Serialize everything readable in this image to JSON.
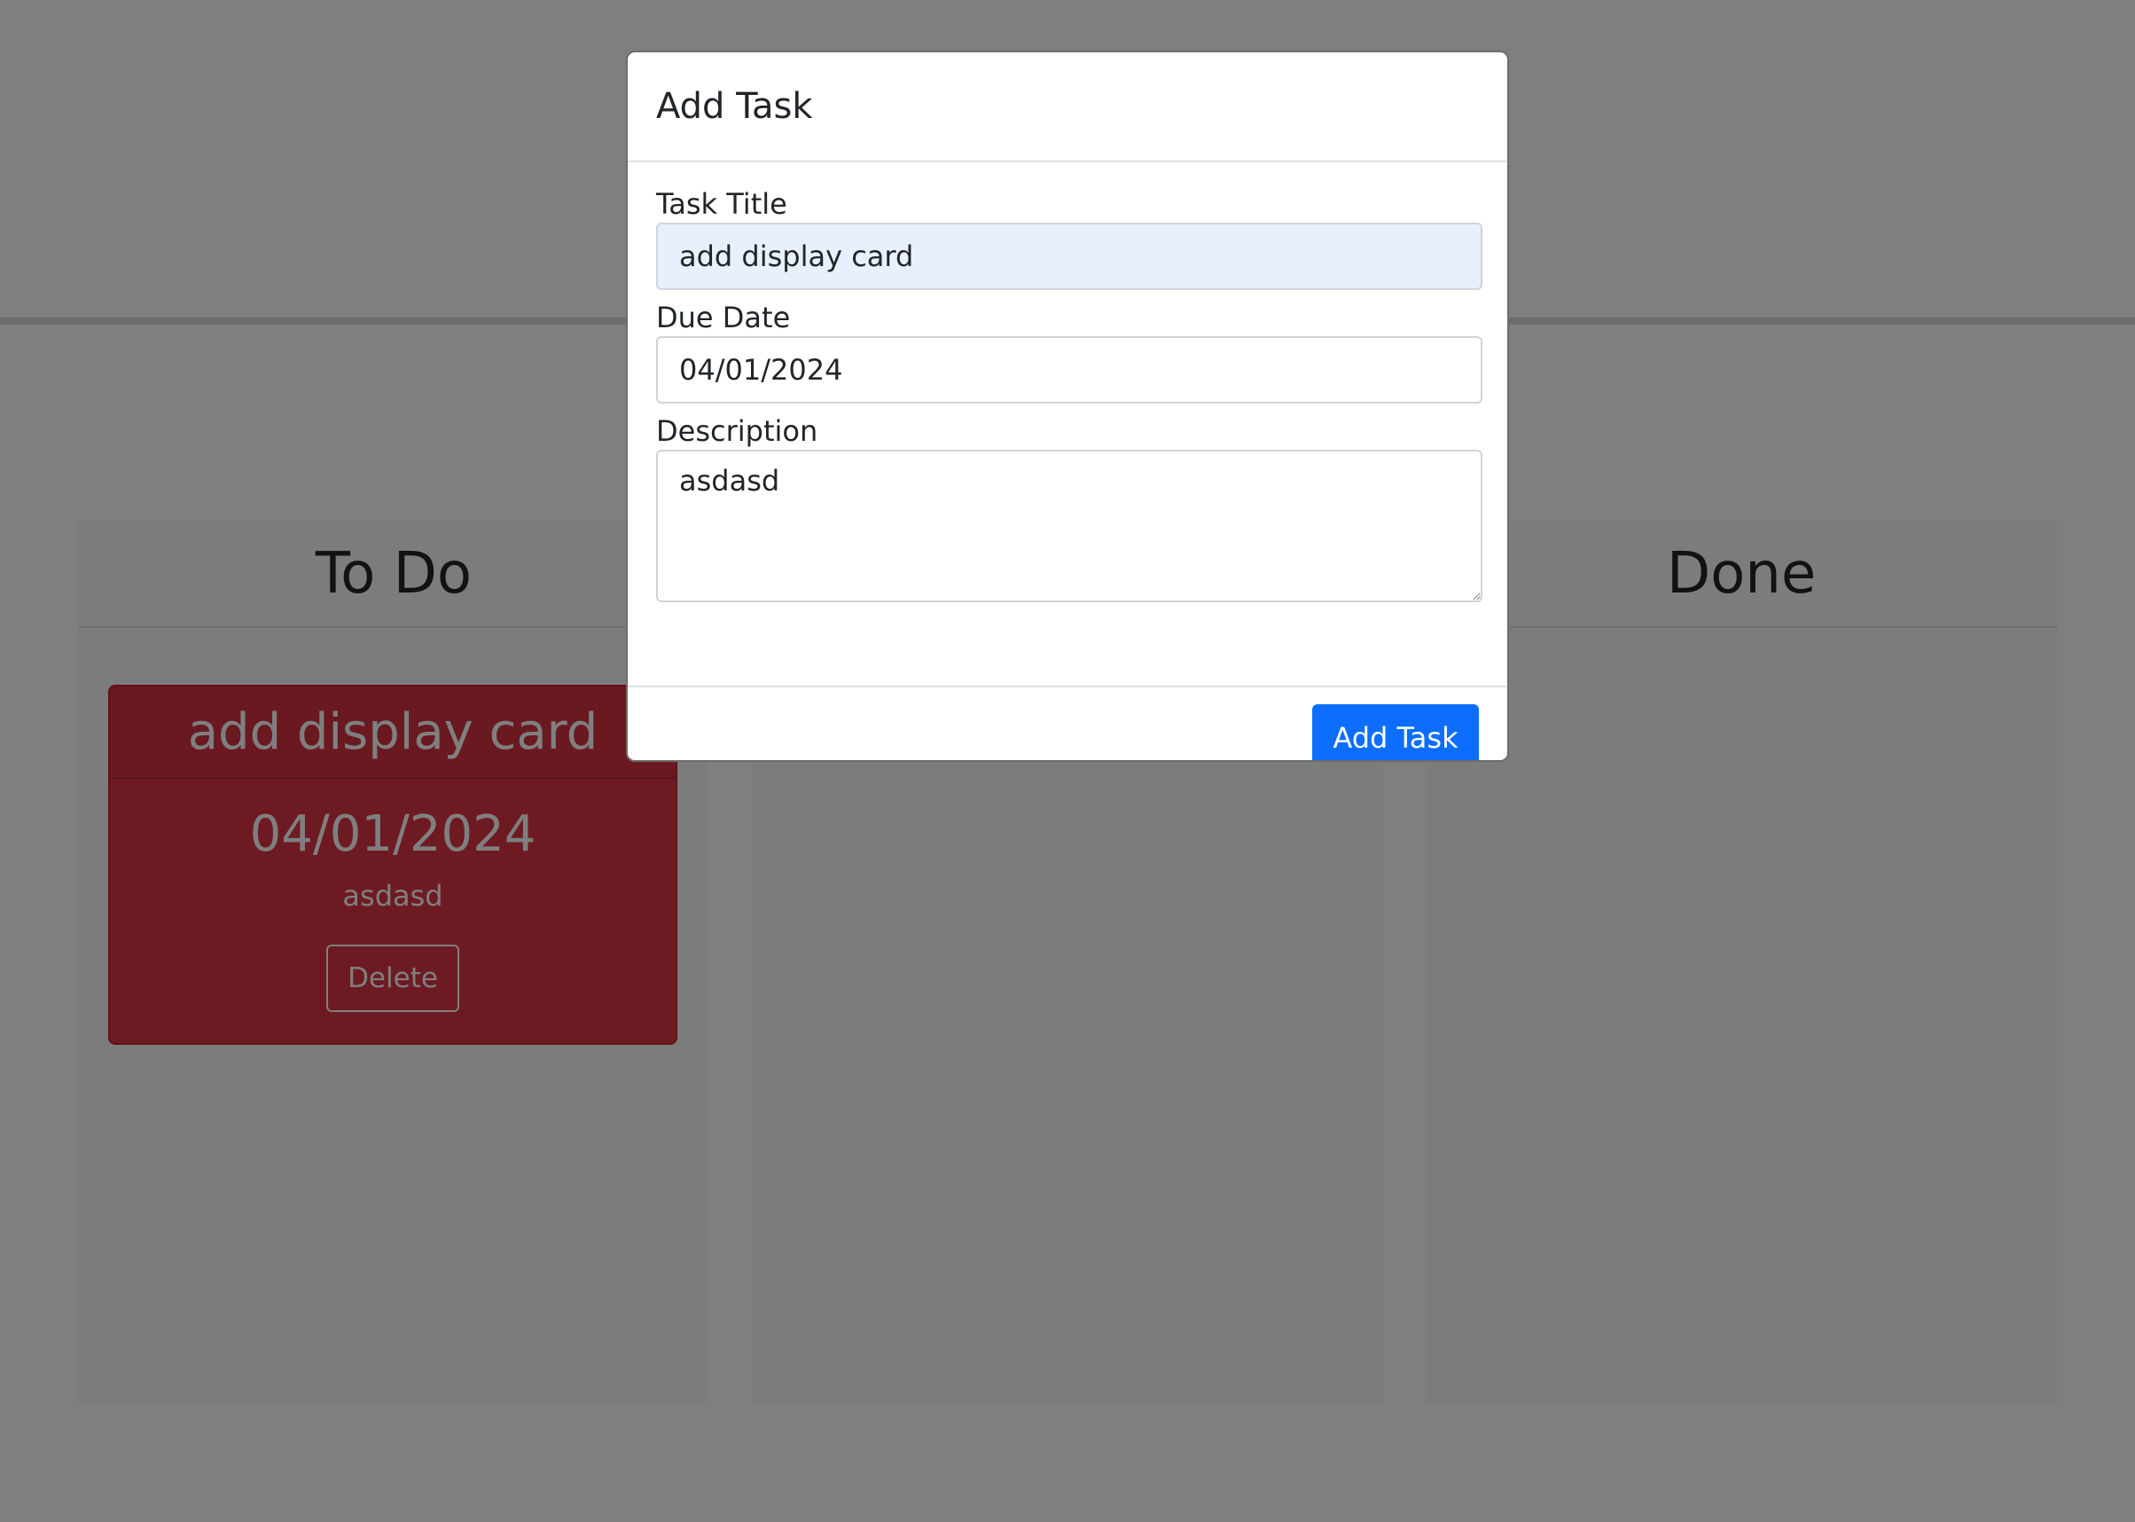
{
  "board": {
    "columns": [
      {
        "title": "To Do"
      },
      {
        "title": ""
      },
      {
        "title": "Done"
      }
    ],
    "card": {
      "title": "add display card",
      "date": "04/01/2024",
      "description": "asdasd",
      "delete_label": "Delete",
      "color": "#dc3545"
    }
  },
  "modal": {
    "title": "Add Task",
    "fields": {
      "title_label": "Task Title",
      "title_value": "add display card",
      "date_label": "Due Date",
      "date_value": "04/01/2024",
      "description_label": "Description",
      "description_value": "asdasd"
    },
    "submit_label": "Add Task",
    "accent": "#0d6efd"
  }
}
